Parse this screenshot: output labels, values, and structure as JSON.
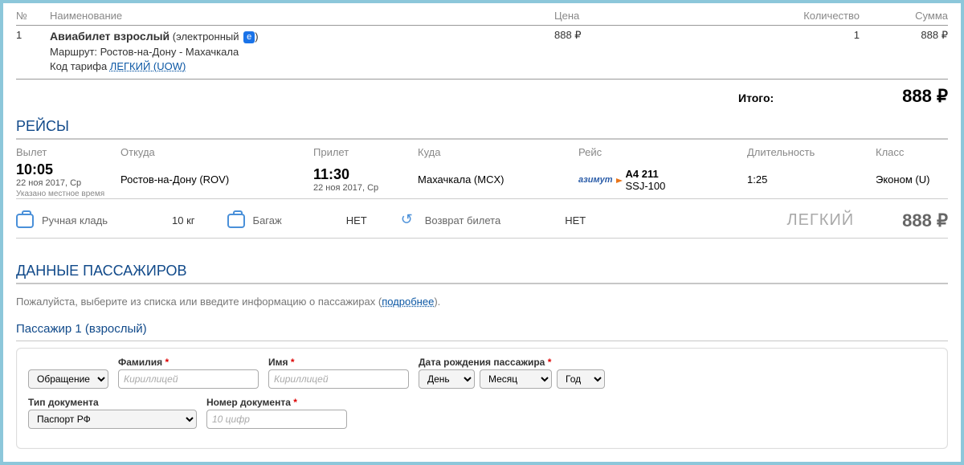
{
  "items_table": {
    "headers": {
      "num": "№",
      "name": "Наименование",
      "price": "Цена",
      "qty": "Количество",
      "sum": "Сумма"
    },
    "row": {
      "num": "1",
      "title": "Авиабилет взрослый",
      "electronic": "электронный",
      "e_badge": "е",
      "route_label": "Маршрут:",
      "route": "Ростов-на-Дону - Махачкала",
      "fare_label": "Код тарифа",
      "fare_link": "ЛЕГКИЙ (UOW)",
      "price": "888 ₽",
      "qty": "1",
      "sum": "888 ₽"
    },
    "total_label": "Итого:",
    "total_value": "888 ₽"
  },
  "flights": {
    "section_title": "РЕЙСЫ",
    "headers": {
      "dep": "Вылет",
      "from": "Откуда",
      "arr": "Прилет",
      "to": "Куда",
      "flight": "Рейс",
      "dur": "Длительность",
      "class": "Класс"
    },
    "row": {
      "dep_time": "10:05",
      "dep_date": "22 ноя 2017, Ср",
      "from": "Ростов-на-Дону (ROV)",
      "arr_time": "11:30",
      "arr_date": "22 ноя 2017, Ср",
      "to": "Махачкала (MCX)",
      "airline_logo": "азимут",
      "flight_no": "A4 211",
      "aircraft": "SSJ-100",
      "duration": "1:25",
      "class": "Эконом (U)"
    },
    "local_time_note": "Указано местное время",
    "baggage": {
      "hand_label": "Ручная кладь",
      "hand_value": "10 кг",
      "bag_label": "Багаж",
      "bag_value": "НЕТ",
      "refund_label": "Возврат билета",
      "refund_value": "НЕТ",
      "tariff_name": "ЛЕГКИЙ",
      "tariff_price": "888 ₽"
    }
  },
  "passengers": {
    "section_title": "ДАННЫЕ ПАССАЖИРОВ",
    "note_prefix": "Пожалуйста, выберите из списка или введите информацию о пассажирах (",
    "note_link": "подробнее",
    "note_suffix": ").",
    "pax1_title": "Пассажир 1 (взрослый)",
    "form": {
      "salutation": "Обращение",
      "surname_label": "Фамилия",
      "surname_ph": "Кириллицей",
      "name_label": "Имя",
      "name_ph": "Кириллицей",
      "dob_label": "Дата рождения пассажира",
      "day": "День",
      "month": "Месяц",
      "year": "Год",
      "doctype_label": "Тип документа",
      "doctype_value": "Паспорт РФ",
      "docnum_label": "Номер документа",
      "docnum_ph": "10 цифр"
    }
  }
}
